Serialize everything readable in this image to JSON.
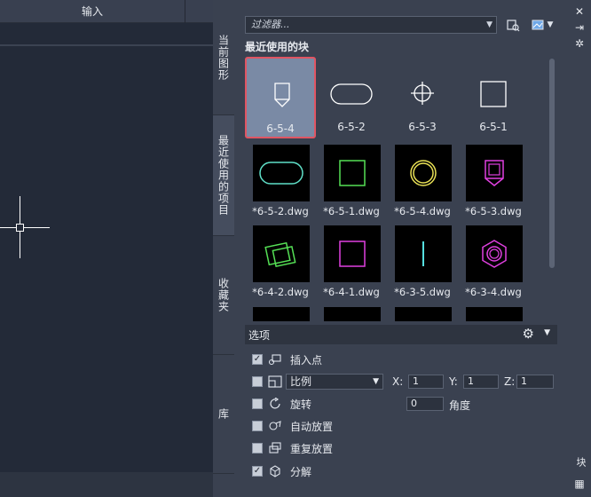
{
  "ribbon": {
    "tab_label": "输入"
  },
  "palette": {
    "side_tabs": [
      "当前图形",
      "最近使用的项目",
      "收藏夹",
      "库"
    ],
    "filter_placeholder": "过滤器...",
    "recent_title": "最近使用的块",
    "recent_blocks": [
      {
        "label": "6-5-4",
        "shape": "tag",
        "selected": true
      },
      {
        "label": "6-5-2",
        "shape": "oval",
        "selected": false
      },
      {
        "label": "6-5-3",
        "shape": "crosshair-circle",
        "selected": false
      },
      {
        "label": "6-5-1",
        "shape": "square",
        "selected": false
      }
    ],
    "thumbnails": [
      {
        "label": "*6-5-2.dwg",
        "shape": "oval",
        "color": "#5fe0c8"
      },
      {
        "label": "*6-5-1.dwg",
        "shape": "square",
        "color": "#55e055"
      },
      {
        "label": "*6-5-4.dwg",
        "shape": "double-circle",
        "color": "#e8e055"
      },
      {
        "label": "*6-5-3.dwg",
        "shape": "tag",
        "color": "#e040e0"
      },
      {
        "label": "*6-4-2.dwg",
        "shape": "tilted-rects",
        "color": "#55e055"
      },
      {
        "label": "*6-4-1.dwg",
        "shape": "square",
        "color": "#e040e0"
      },
      {
        "label": "*6-3-5.dwg",
        "shape": "vline",
        "color": "#55e0e0"
      },
      {
        "label": "*6-3-4.dwg",
        "shape": "hex-nut",
        "color": "#e040e0"
      }
    ],
    "options": {
      "title": "选项",
      "insert_point": {
        "label": "插入点",
        "checked": true
      },
      "scale": {
        "checked": false,
        "mode": "比例",
        "x_label": "X:",
        "x": "1",
        "y_label": "Y:",
        "y": "1",
        "z_label": "Z:",
        "z": "1"
      },
      "rotate": {
        "label": "旋转",
        "checked": false,
        "angle": "0",
        "angle_label": "角度"
      },
      "auto_place": {
        "label": "自动放置",
        "checked": false
      },
      "repeat_place": {
        "label": "重复放置",
        "checked": false
      },
      "explode": {
        "label": "分解",
        "checked": true
      }
    }
  },
  "right_strip": {
    "vertical_label": "块"
  }
}
